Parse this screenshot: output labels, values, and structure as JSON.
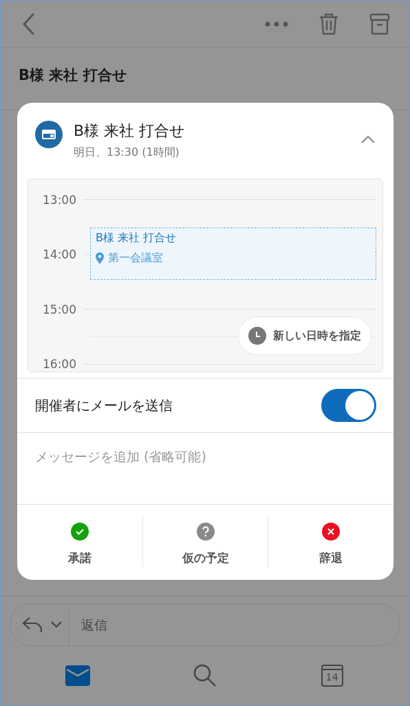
{
  "subject": "B様 来社 打合せ",
  "invite": {
    "title": "B様 来社 打合せ",
    "when": "明日、13:30 (1時間)",
    "expanded": true
  },
  "calendar": {
    "hours": [
      "13:00",
      "14:00",
      "15:00",
      "16:00"
    ],
    "event": {
      "title": "B様 来社 打合せ",
      "location": "第一会議室"
    },
    "propose_button": "新しい日時を指定"
  },
  "email_toggle": {
    "label": "開催者にメールを送信",
    "on": true
  },
  "message": {
    "placeholder": "メッセージを追加 (省略可能)"
  },
  "actions": [
    {
      "kind": "accept",
      "label": "承諾"
    },
    {
      "kind": "tentative",
      "label": "仮の予定"
    },
    {
      "kind": "decline",
      "label": "辞退"
    }
  ],
  "reply": {
    "placeholder": "返信"
  },
  "tab_bar": [
    {
      "kind": "mail",
      "selected": true
    },
    {
      "kind": "search",
      "selected": false
    },
    {
      "kind": "calendar",
      "selected": false,
      "label": "14"
    }
  ]
}
